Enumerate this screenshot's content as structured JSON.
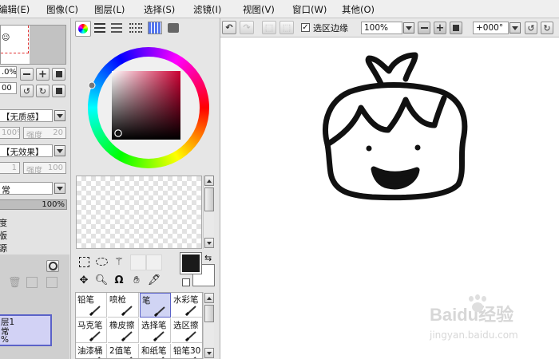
{
  "menu": [
    "编辑(E)",
    "图像(C)",
    "图层(L)",
    "选择(S)",
    "滤镜(I)",
    "视图(V)",
    "窗口(W)",
    "其他(O)"
  ],
  "left_panel": {
    "zoom_value": ".0%",
    "angle_value": "00",
    "texture_select": "【无质感】",
    "texture_percent": "100%",
    "texture_strength_label": "强度",
    "texture_strength_value": "20",
    "effect_select": "【无效果】",
    "effect_value": "1",
    "effect_strength_label": "强度",
    "effect_strength_value": "100",
    "blend_select": "常",
    "opacity_value": "100%",
    "option_labels": [
      "度",
      "版",
      "源"
    ],
    "layer": {
      "name": "层1",
      "mode": "常",
      "opacity": "%"
    }
  },
  "canvas_toolbar": {
    "selection_edge_label": "选区边缘",
    "selection_edge_checked": true,
    "zoom_value": "100%",
    "rotation_value": "+000°"
  },
  "tools": {
    "primary_color": "#1a1a1a",
    "secondary_color": "#ffffff",
    "accent": "#5b62c8"
  },
  "brushes": [
    [
      "铅笔",
      "喷枪",
      "笔",
      "水彩笔"
    ],
    [
      "马克笔",
      "橡皮擦",
      "选择笔",
      "选区擦"
    ],
    [
      "油漆桶",
      "2值笔",
      "和纸笔",
      "铅笔30"
    ]
  ],
  "watermark": {
    "brand": "Baidu经验",
    "url": "jingyan.baidu.com"
  }
}
